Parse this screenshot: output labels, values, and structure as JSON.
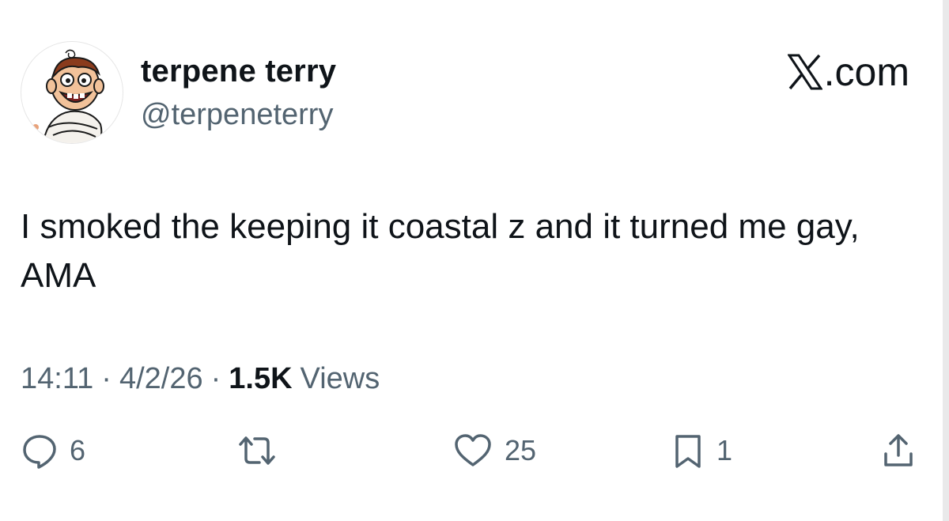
{
  "author": {
    "display_name": "terpene terry",
    "handle": "@terpeneterry",
    "avatar_icon": "cartoon-avatar-icon"
  },
  "brand": {
    "label": ".com",
    "icon": "x-logo-icon"
  },
  "tweet": {
    "text": "I smoked the keeping it coastal z and it turned me gay, AMA"
  },
  "meta": {
    "time": "14:11",
    "separator": "·",
    "date": "4/2/26",
    "views_count": "1.5K",
    "views_label": "Views"
  },
  "actions": {
    "reply": {
      "icon": "reply-icon",
      "count": "6"
    },
    "retweet": {
      "icon": "retweet-icon",
      "count": ""
    },
    "like": {
      "icon": "heart-icon",
      "count": "25"
    },
    "bookmark": {
      "icon": "bookmark-icon",
      "count": "1"
    },
    "share": {
      "icon": "share-icon",
      "count": ""
    }
  },
  "colors": {
    "text": "#0f1419",
    "secondary": "#536471",
    "background": "#ffffff"
  }
}
